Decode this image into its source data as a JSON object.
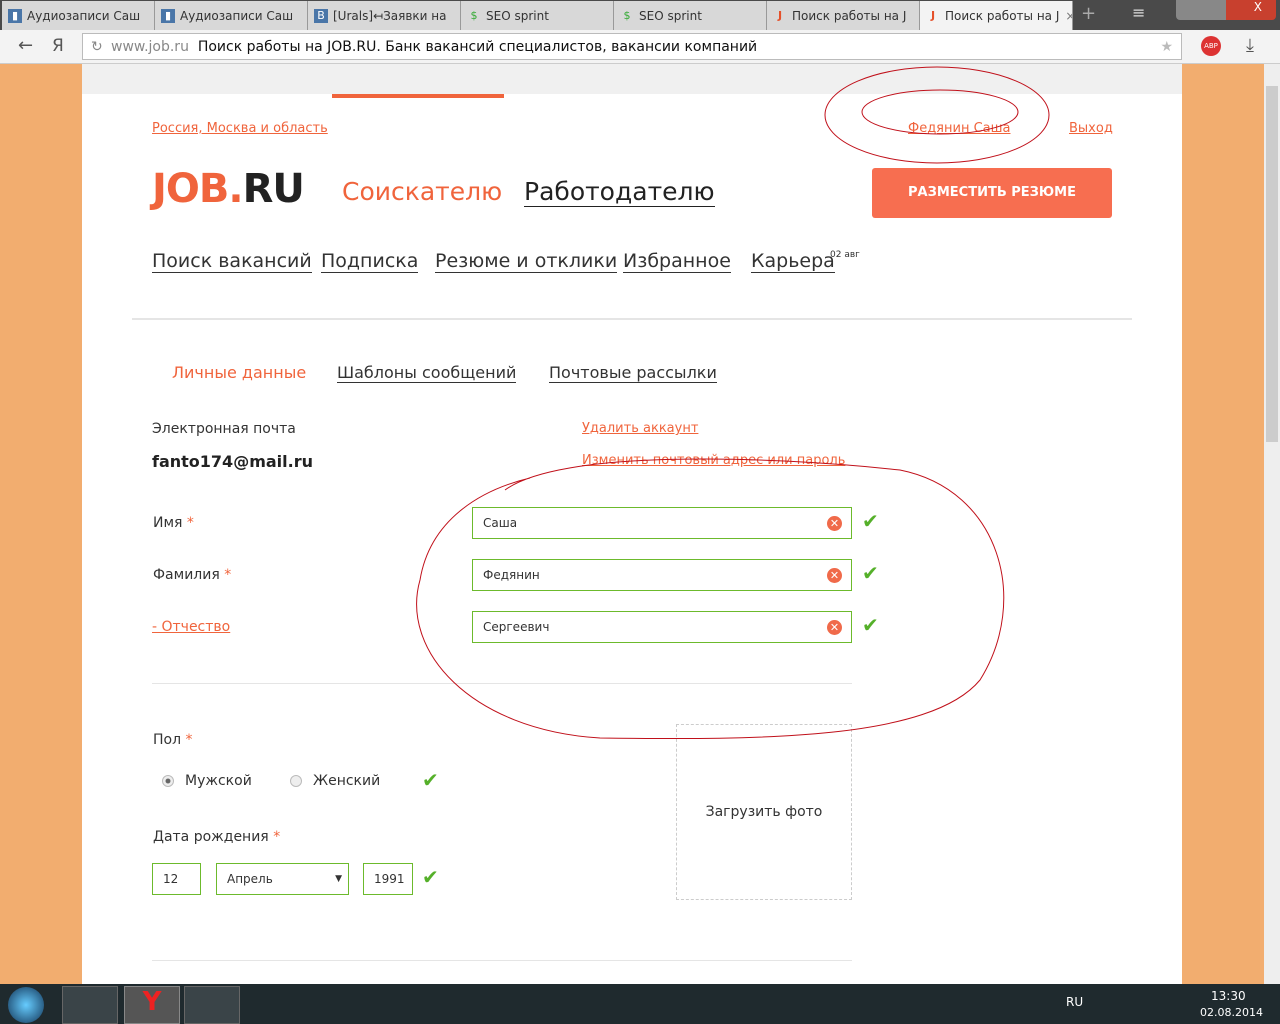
{
  "browser": {
    "tabs": [
      "Аудиозаписи Саш",
      "Аудиозаписи Саш",
      "[Urals]↤Заявки на",
      "SEO sprint",
      "SEO sprint",
      "Поиск работы на J",
      "Поиск работы на J"
    ],
    "url_domain": "www.job.ru",
    "page_title": "Поиск работы на JOB.RU. Банк вакансий специалистов, вакансии компаний"
  },
  "header": {
    "region": "Россия, Москва и область",
    "user": "Федянин Саша",
    "logout": "Выход",
    "logo": "JOB.RU",
    "seeker": "Соискателю",
    "employer": "Работодателю",
    "post_resume": "РАЗМЕСТИТЬ РЕЗЮМЕ"
  },
  "nav": [
    "Поиск вакансий",
    "Подписка",
    "Резюме и отклики",
    "Избранное",
    "Карьера"
  ],
  "nav_badge": "02 авг",
  "subtabs": [
    "Личные данные",
    "Шаблоны сообщений",
    "Почтовые рассылки"
  ],
  "form": {
    "email_label": "Электронная почта",
    "email": "fanto174@mail.ru",
    "delete_account": "Удалить аккаунт",
    "change_email": "Изменить почтовый адрес или пароль",
    "name_label": "Имя",
    "name": "Саша",
    "surname_label": "Фамилия",
    "surname": "Федянин",
    "patronymic_label": "- Отчество",
    "patronymic": "Сергеевич",
    "gender_label": "Пол",
    "male": "Мужской",
    "female": "Женский",
    "birth_label": "Дата рождения",
    "day": "12",
    "month": "Апрель",
    "year": "1991",
    "upload_photo": "Загрузить фото"
  },
  "taskbar": {
    "lang": "RU",
    "time": "13:30",
    "date": "02.08.2014"
  }
}
